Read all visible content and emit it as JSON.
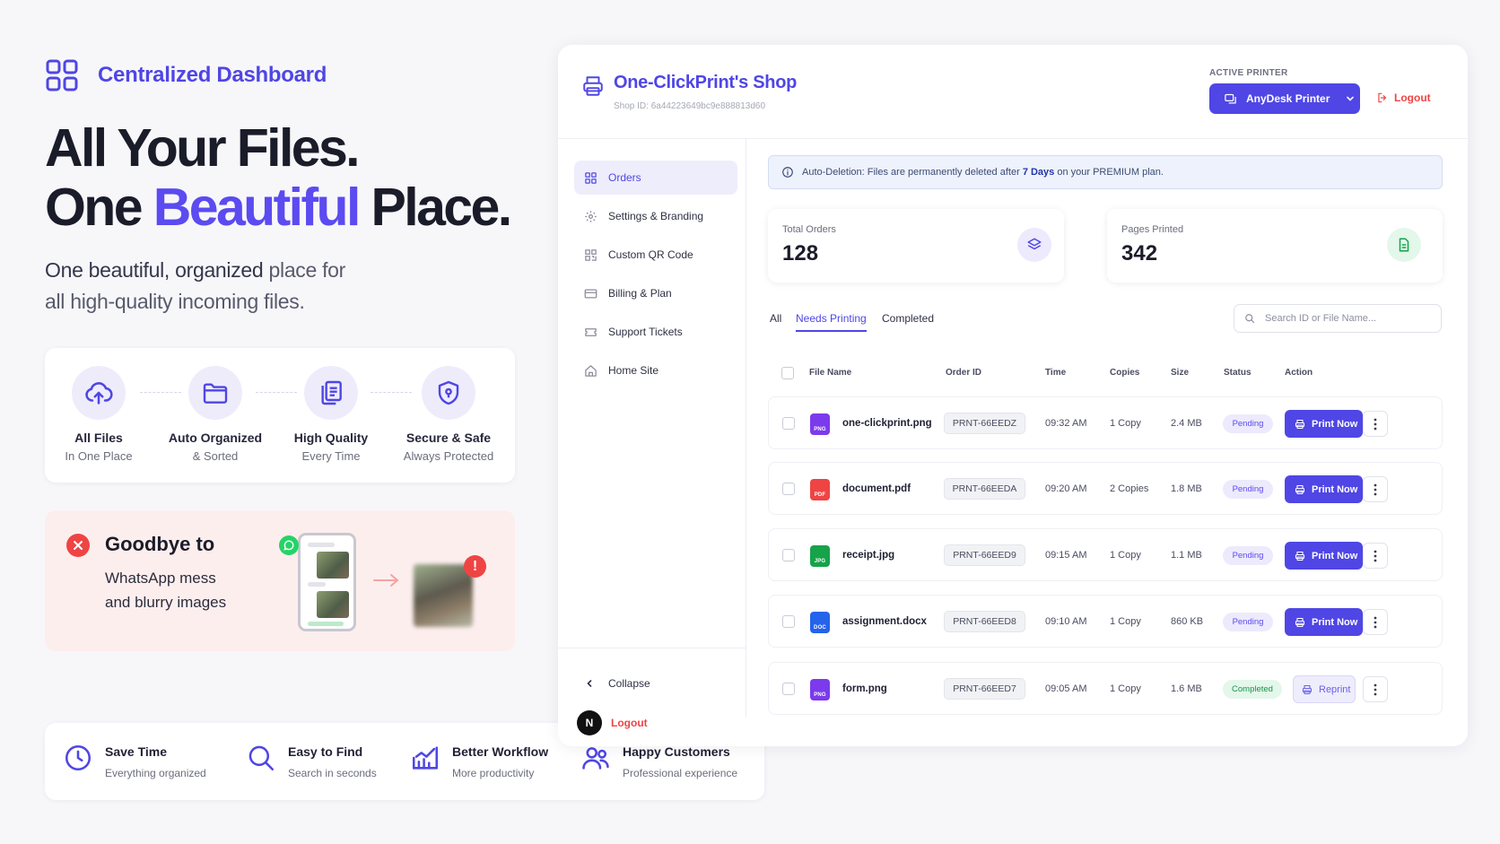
{
  "brand": {
    "title": "Centralized Dashboard"
  },
  "hero": {
    "line1": "All Your Files.",
    "line2_pre": "One ",
    "line2_accent": "Beautiful",
    "line2_post": " Place.",
    "sub_strong": "One beautiful, organized",
    "sub_rest": " place for",
    "sub_line2": "all high-quality incoming files."
  },
  "features": [
    {
      "title": "All Files",
      "sub": "In One Place",
      "icon": "cloud-upload-icon"
    },
    {
      "title": "Auto Organized",
      "sub": "& Sorted",
      "icon": "folder-icon"
    },
    {
      "title": "High Quality",
      "sub": "Every Time",
      "icon": "files-icon"
    },
    {
      "title": "Secure & Safe",
      "sub": "Always Protected",
      "icon": "shield-icon"
    }
  ],
  "goodbye": {
    "title": "Goodbye to",
    "line1": "WhatsApp mess",
    "line2": "and blurry images",
    "alert_mark": "!"
  },
  "benefits": [
    {
      "title": "Save Time",
      "sub": "Everything organized",
      "icon": "clock-icon"
    },
    {
      "title": "Easy to Find",
      "sub": "Search in seconds",
      "icon": "search-icon"
    },
    {
      "title": "Better Workflow",
      "sub": "More productivity",
      "icon": "chart-icon"
    },
    {
      "title": "Happy Customers",
      "sub": "Professional experience",
      "icon": "users-icon"
    }
  ],
  "app": {
    "shop_name": "One-ClickPrint's Shop",
    "shop_id": "Shop ID: 6a44223649bc9e888813d60",
    "active_printer_label": "ACTIVE PRINTER",
    "printer_name": "AnyDesk Printer",
    "logout": "Logout",
    "nav": [
      {
        "label": "Orders",
        "icon": "grid-icon",
        "active": true
      },
      {
        "label": "Settings & Branding",
        "icon": "gear-icon"
      },
      {
        "label": "Custom QR Code",
        "icon": "qr-code-icon"
      },
      {
        "label": "Billing & Plan",
        "icon": "credit-card-icon"
      },
      {
        "label": "Support Tickets",
        "icon": "ticket-icon"
      },
      {
        "label": "Home Site",
        "icon": "home-icon"
      }
    ],
    "collapse": "Collapse",
    "avatar_initial": "N",
    "alert": {
      "pre": "Auto-Deletion: Files are permanently deleted after ",
      "bold": "7 Days",
      "post": " on your PREMIUM plan."
    },
    "stats": [
      {
        "label": "Total Orders",
        "value": "128",
        "icon": "layers-icon"
      },
      {
        "label": "Pages Printed",
        "value": "342",
        "icon": "document-icon"
      }
    ],
    "tabs": [
      "All",
      "Needs Printing",
      "Completed"
    ],
    "active_tab": "Needs Printing",
    "search_placeholder": "Search ID or File Name...",
    "columns": [
      "File Name",
      "Order ID",
      "Time",
      "Copies",
      "Size",
      "Status",
      "Action"
    ],
    "rows": [
      {
        "file": "one-clickprint.png",
        "type": "PNG",
        "color": "#7c3aed",
        "order": "PRNT-66EEDZ",
        "time": "09:32 AM",
        "copies": "1 Copy",
        "size": "2.4 MB",
        "status": "Pending",
        "action": "Print Now"
      },
      {
        "file": "document.pdf",
        "type": "PDF",
        "color": "#ef4444",
        "order": "PRNT-66EEDA",
        "time": "09:20 AM",
        "copies": "2 Copies",
        "size": "1.8 MB",
        "status": "Pending",
        "action": "Print Now"
      },
      {
        "file": "receipt.jpg",
        "type": "JPG",
        "color": "#16a34a",
        "order": "PRNT-66EED9",
        "time": "09:15 AM",
        "copies": "1 Copy",
        "size": "1.1 MB",
        "status": "Pending",
        "action": "Print Now"
      },
      {
        "file": "assignment.docx",
        "type": "DOC",
        "color": "#2563eb",
        "order": "PRNT-66EED8",
        "time": "09:10 AM",
        "copies": "1 Copy",
        "size": "860 KB",
        "status": "Pending",
        "action": "Print Now"
      },
      {
        "file": "form.png",
        "type": "PNG",
        "color": "#7c3aed",
        "order": "PRNT-66EED7",
        "time": "09:05 AM",
        "copies": "1 Copy",
        "size": "1.6 MB",
        "status": "Completed",
        "action": "Reprint"
      }
    ]
  }
}
